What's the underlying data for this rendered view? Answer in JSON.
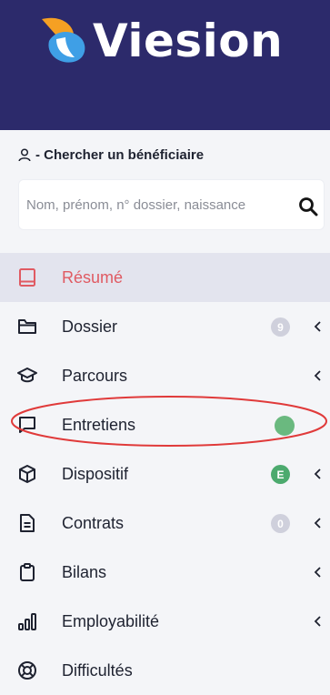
{
  "app": {
    "logo_text": "Viesion",
    "brand_colors": {
      "header": "#2c2a6b",
      "logo_orange": "#f5a023",
      "logo_blue": "#3f9fe6",
      "active_text": "#e05a62",
      "badge_green": "#4caa6e",
      "status_dot": "#6ab97f",
      "annotation": "#e03a3a"
    }
  },
  "search": {
    "label": "- Chercher un bénéficiaire",
    "label_icon": "user-icon",
    "placeholder": "Nom, prénom, n° dossier, naissance",
    "value": "",
    "button_icon": "search-icon"
  },
  "menu": {
    "items": [
      {
        "label": "Résumé",
        "icon": "book-icon",
        "active": true,
        "badge": null,
        "chevron": false
      },
      {
        "label": "Dossier",
        "icon": "folder-icon",
        "active": false,
        "badge": "9",
        "chevron": true
      },
      {
        "label": "Parcours",
        "icon": "graduation-cap-icon",
        "active": false,
        "badge": null,
        "chevron": true
      },
      {
        "label": "Entretiens",
        "icon": "message-square-icon",
        "active": false,
        "status_dot": true,
        "chevron": false
      },
      {
        "label": "Dispositif",
        "icon": "cube-icon",
        "active": false,
        "badge": "E",
        "chevron": true
      },
      {
        "label": "Contrats",
        "icon": "document-icon",
        "active": false,
        "badge": "0",
        "chevron": true
      },
      {
        "label": "Bilans",
        "icon": "clipboard-icon",
        "active": false,
        "badge": null,
        "chevron": true
      },
      {
        "label": "Employabilité",
        "icon": "bar-chart-icon",
        "active": false,
        "badge": null,
        "chevron": true
      },
      {
        "label": "Difficultés",
        "icon": "lifebuoy-icon",
        "active": false,
        "badge": null,
        "chevron": false
      }
    ]
  }
}
